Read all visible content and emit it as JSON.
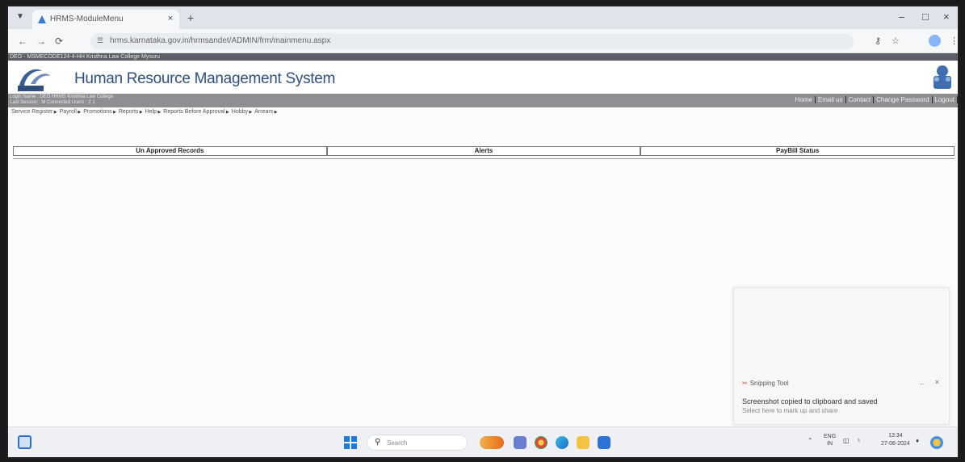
{
  "browser": {
    "tab_title": "HRMS-ModuleMenu",
    "tab_close": "×",
    "new_tab": "+",
    "url": "hrms.karnataka.gov.in/hrmsandet/ADMIN/frm/mainmenu.aspx",
    "window_controls": [
      "–",
      "□",
      "×"
    ]
  },
  "page": {
    "top_strip": "DEO - MSMECODE124-4-HH Kristhna Law College Mysuru",
    "app_title": "Human Resource Management System",
    "info_line1": "Login Name : DEO HRMS Kristhna Law College",
    "info_line2": "Last Session : M Connected Users : 2 1",
    "top_links": [
      "Home",
      "Email us",
      "Contact",
      "Change Password",
      "Logout"
    ],
    "menu": [
      "Service Register",
      "Payroll",
      "Promotions",
      "Reports",
      "Help",
      "Reports Before Approval",
      "Hobby",
      "Arrears"
    ],
    "panels": [
      "Un Approved Records",
      "Alerts",
      "PayBill Status"
    ]
  },
  "toast": {
    "app_name": "Snipping Tool",
    "dots": "...",
    "close": "×",
    "message": "Screenshot copied to clipboard and saved",
    "sub": "Select here to mark up and share"
  },
  "taskbar": {
    "search_placeholder": "Search",
    "tray_lang_1": "ENG",
    "tray_lang_2": "IN",
    "time": "13:34",
    "date": "27-06-2024"
  },
  "colors": {
    "title_blue": "#2f4f7d",
    "header_gray": "#8d8f92",
    "accent": "#1f7ae0"
  }
}
